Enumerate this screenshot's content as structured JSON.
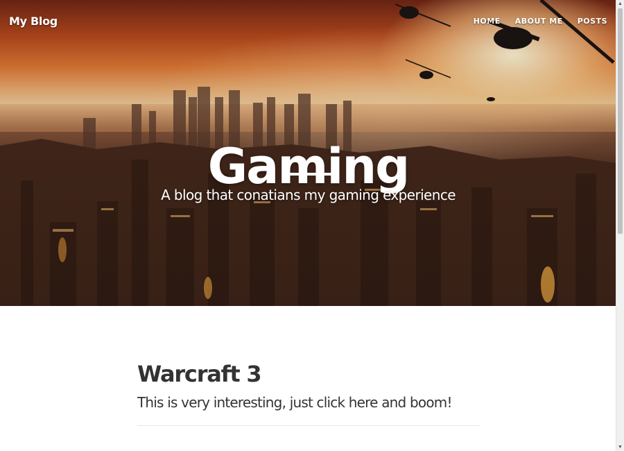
{
  "navbar": {
    "brand": "My Blog",
    "links": [
      "HOME",
      "ABOUT ME",
      "POSTS"
    ]
  },
  "hero": {
    "heading": "Gaming",
    "subheading": "A blog that conatians my gaming experience"
  },
  "posts": [
    {
      "title": "Warcraft 3",
      "subtitle": "This is very interesting, just click here and boom!"
    }
  ],
  "colors": {
    "text": "#333333",
    "hero_sky": "#e07a36",
    "hero_text": "#ffffff"
  }
}
